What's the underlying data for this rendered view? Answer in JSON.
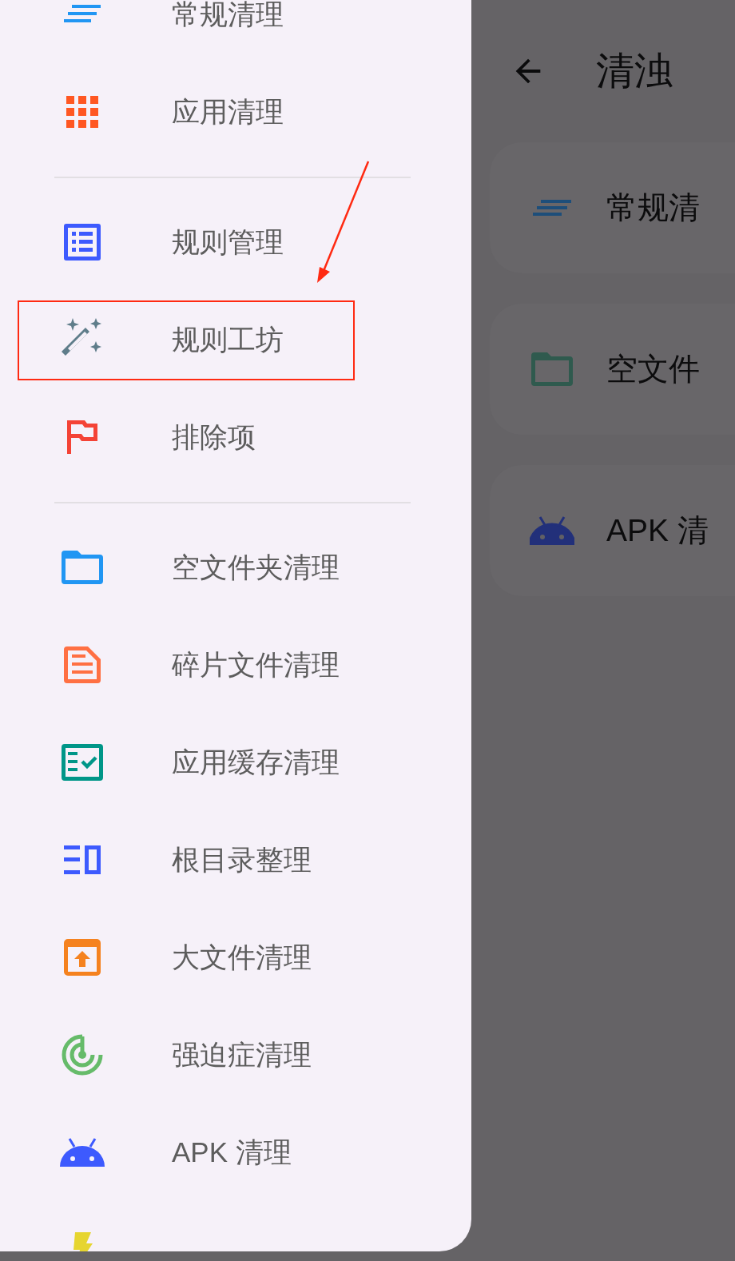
{
  "background_screen": {
    "title": "清浊",
    "cards": [
      {
        "kind": "lines",
        "label": "常规清"
      },
      {
        "kind": "folder",
        "label": "空文件"
      },
      {
        "kind": "android",
        "label": "APK 清"
      }
    ]
  },
  "drawer": {
    "groups": [
      {
        "items": [
          {
            "kind": "lines",
            "label": "常规清理",
            "annotated": false
          },
          {
            "kind": "grid",
            "label": "应用清理",
            "annotated": false
          }
        ]
      },
      {
        "items": [
          {
            "kind": "listbox",
            "label": "规则管理",
            "annotated": false
          },
          {
            "kind": "wand",
            "label": "规则工坊",
            "annotated": true
          },
          {
            "kind": "flag",
            "label": "排除项",
            "annotated": false
          }
        ]
      },
      {
        "items": [
          {
            "kind": "folder",
            "label": "空文件夹清理",
            "annotated": false
          },
          {
            "kind": "document",
            "label": "碎片文件清理",
            "annotated": false
          },
          {
            "kind": "checklist",
            "label": "应用缓存清理",
            "annotated": false
          },
          {
            "kind": "columns",
            "label": "根目录整理",
            "annotated": false
          },
          {
            "kind": "archive",
            "label": "大文件清理",
            "annotated": false
          },
          {
            "kind": "radar",
            "label": "强迫症清理",
            "annotated": false
          },
          {
            "kind": "android",
            "label": "APK 清理",
            "annotated": false
          },
          {
            "kind": "bolt",
            "annotated": false
          }
        ]
      }
    ]
  }
}
